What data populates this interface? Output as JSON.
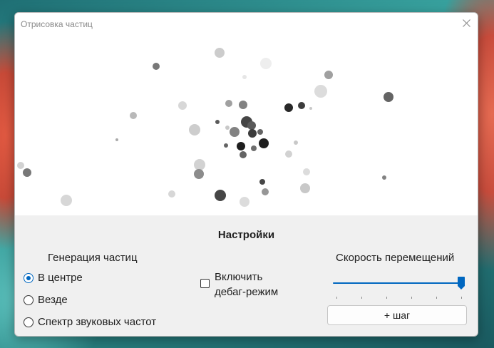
{
  "window": {
    "title": "Отрисовка частиц"
  },
  "settings": {
    "title": "Настройки",
    "generation": {
      "label": "Генерация частиц",
      "options": [
        {
          "label": "В центре",
          "checked": true
        },
        {
          "label": "Везде",
          "checked": false
        },
        {
          "label": "Спектр звуковых частот",
          "checked": false
        }
      ]
    },
    "debug": {
      "label_line1": "Включить",
      "label_line2": "дебаг-режим",
      "checked": false
    },
    "speed": {
      "label": "Скорость перемещений",
      "value": 1.0,
      "tick_count": 6
    },
    "step_button": "+ шаг"
  },
  "colors": {
    "accent": "#0067c0",
    "canvas_background": "#ffffff",
    "panel_background": "#f0f0f0"
  }
}
